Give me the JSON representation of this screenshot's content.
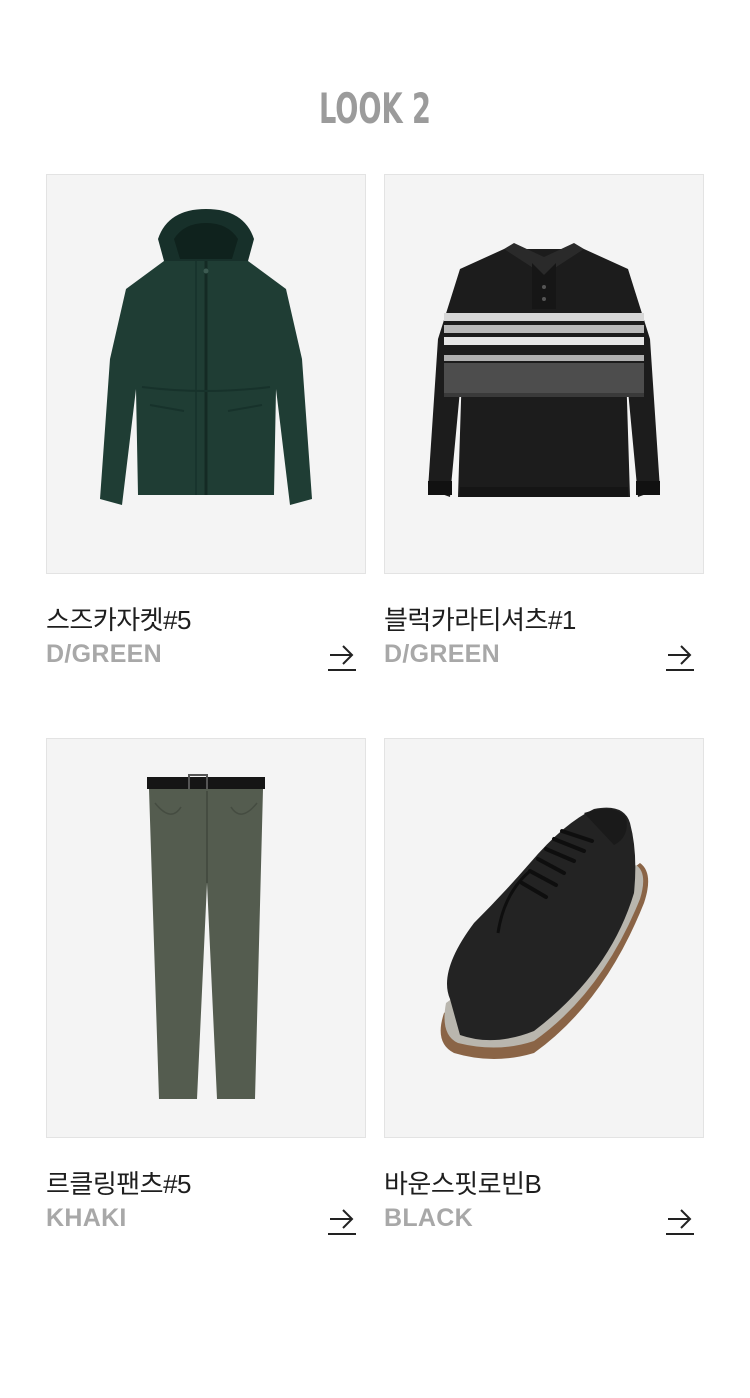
{
  "look": {
    "title": "LOOK 2"
  },
  "products": [
    {
      "name": "스즈카자켓#5",
      "color": "D/GREEN",
      "image_icon": "jacket-icon",
      "arrow_icon": "arrow-right-icon"
    },
    {
      "name": "블럭카라티셔츠#1",
      "color": "D/GREEN",
      "image_icon": "polo-shirt-icon",
      "arrow_icon": "arrow-right-icon"
    },
    {
      "name": "르클링팬츠#5",
      "color": "KHAKI",
      "image_icon": "pants-icon",
      "arrow_icon": "arrow-right-icon"
    },
    {
      "name": "바운스핏로빈B",
      "color": "BLACK",
      "image_icon": "shoe-icon",
      "arrow_icon": "arrow-right-icon"
    }
  ],
  "colors": {
    "title_gray": "#9b9b9b",
    "tile_bg": "#f4f4f4",
    "jacket_green": "#1f3d34",
    "polo_black": "#1c1c1c",
    "pants_khaki": "#545c4f",
    "shoe_black": "#232323"
  }
}
